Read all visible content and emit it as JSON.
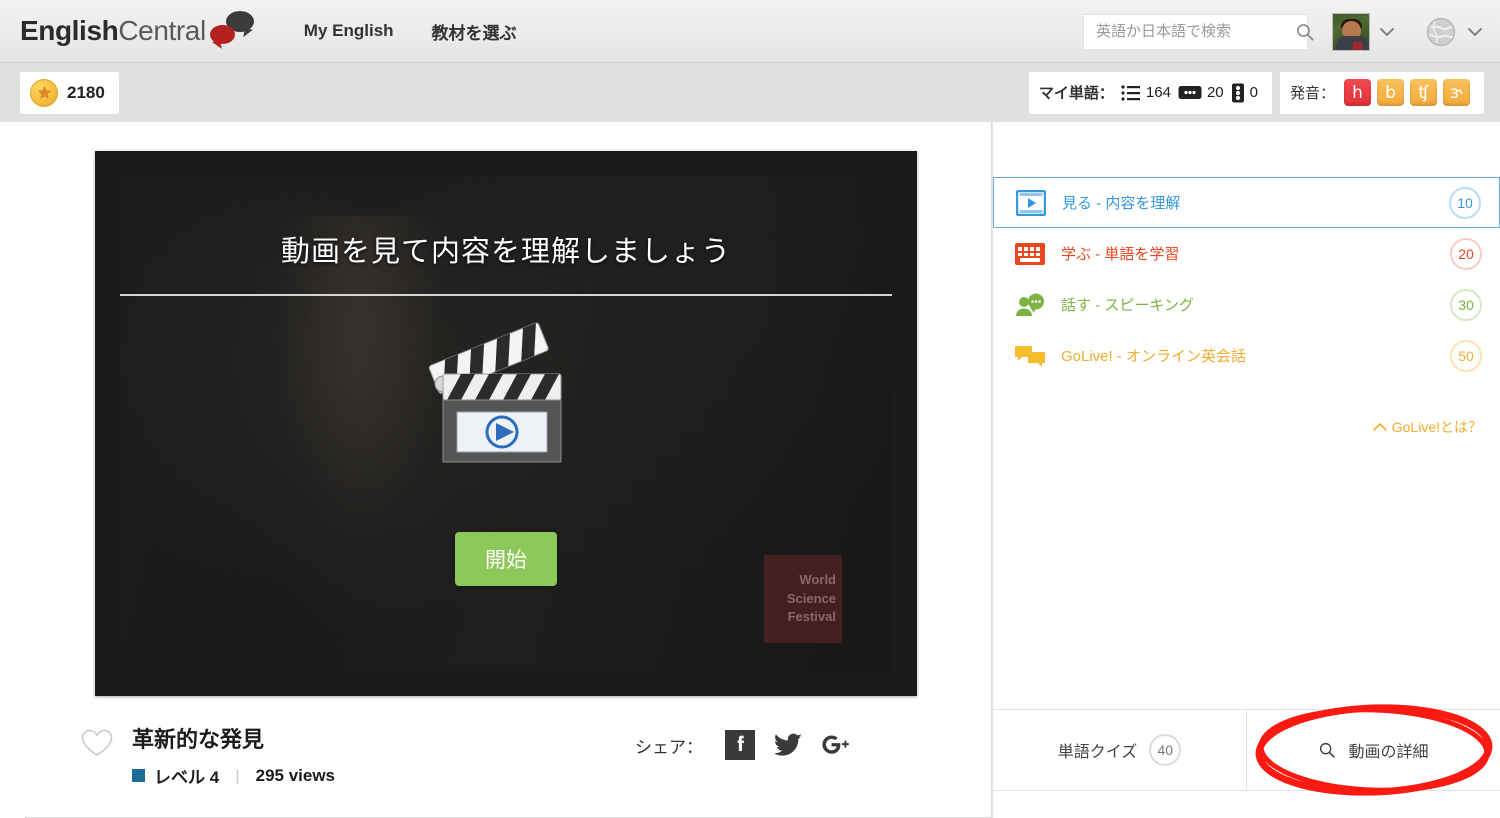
{
  "header": {
    "logo": {
      "bold": "English",
      "light": "Central",
      "icon": "speech-bubbles-icon"
    },
    "nav": [
      {
        "label": "My English"
      },
      {
        "label": "教材を選ぶ"
      }
    ],
    "search": {
      "placeholder": "英語か日本語で検索",
      "value": "",
      "icon": "search-icon"
    },
    "avatar_alt": "user-avatar",
    "language_icon": "globe-icon"
  },
  "stats": {
    "points": "2180",
    "points_icon": "star-coin-icon",
    "myword_label": "マイ単語：",
    "myword_items": [
      {
        "icon": "word-list-icon",
        "value": "164"
      },
      {
        "icon": "flashcard-icon",
        "value": "20"
      },
      {
        "icon": "traffic-light-icon",
        "value": "0"
      }
    ],
    "pronunciation_label": "発音：",
    "phonemes": [
      {
        "symbol": "h",
        "color": "#e03138"
      },
      {
        "symbol": "b",
        "color": "#f2a93c"
      },
      {
        "symbol": "ʧ",
        "color": "#f2a93c"
      },
      {
        "symbol": "ɝ",
        "color": "#f2a93c"
      }
    ]
  },
  "video": {
    "overlay_title": "動画を見て内容を理解しましょう",
    "start_button": "開始",
    "play_icon": "clapperboard-play-icon",
    "watermark": [
      "World",
      "Science",
      "Festival"
    ]
  },
  "meta": {
    "favorite_icon": "heart-outline-icon",
    "title": "革新的な発見",
    "level": "レベル 4",
    "level_color": "#1f6a96",
    "views": "295 views",
    "share_label": "シェア：",
    "share_icons": [
      "facebook-icon",
      "twitter-icon",
      "googleplus-icon"
    ]
  },
  "sidebar": {
    "activities": [
      {
        "icon": "film-play-icon",
        "label": "見る - 内容を理解",
        "points": "10",
        "color": "#3498db",
        "active": true
      },
      {
        "icon": "keyboard-icon",
        "label": "学ぶ - 単語を学習",
        "points": "20",
        "color": "#e8471f",
        "active": false
      },
      {
        "icon": "speaking-person-icon",
        "label": "話す - スピーキング",
        "points": "30",
        "color": "#7cb342",
        "active": false
      },
      {
        "icon": "chat-bubbles-icon",
        "label": "GoLive! - オンライン英会話",
        "points": "50",
        "color": "#f5bc2c",
        "active": false
      }
    ],
    "golive_link": "GoLive!とは？",
    "golive_chevron": "chevron-up-icon",
    "bottom": {
      "quiz_label": "単語クイズ",
      "quiz_points": "40",
      "detail_label": "動画の詳細",
      "detail_icon": "search-icon",
      "annotation": "red-ellipse-annotation"
    }
  }
}
